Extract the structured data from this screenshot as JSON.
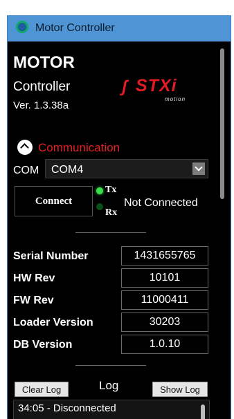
{
  "window": {
    "title": "Motor Controller"
  },
  "header": {
    "title_big": "MOTOR",
    "title_sub": "Controller",
    "version": "Ver. 1.3.38a",
    "logo": {
      "word": "STXi",
      "sub": "motion",
      "color": "#e21c24"
    }
  },
  "communication": {
    "section_label": "Communication",
    "com_label": "COM",
    "com_value": "COM4",
    "connect_label": "Connect",
    "tx_label": "Tx",
    "rx_label": "Rx",
    "status": "Not Connected"
  },
  "info": {
    "rows": [
      {
        "label": "Serial Number",
        "value": "1431655765"
      },
      {
        "label": "HW Rev",
        "value": "10101"
      },
      {
        "label": "FW Rev",
        "value": "11000411"
      },
      {
        "label": "Loader Version",
        "value": "30203"
      },
      {
        "label": "DB Version",
        "value": "1.0.10"
      }
    ]
  },
  "log": {
    "title": "Log",
    "clear_label": "Clear Log",
    "show_label": "Show Log",
    "entries": [
      "34:05 - Disconnected"
    ]
  },
  "colors": {
    "accent_red": "#e41f22",
    "titlebar_blue": "#4f95d6",
    "led_on": "#35e04a",
    "led_off": "#0b4d17"
  },
  "icons": {
    "app": "app-circle-icon",
    "collapse": "chevron-up-icon",
    "dropdown": "chevron-down-icon"
  }
}
